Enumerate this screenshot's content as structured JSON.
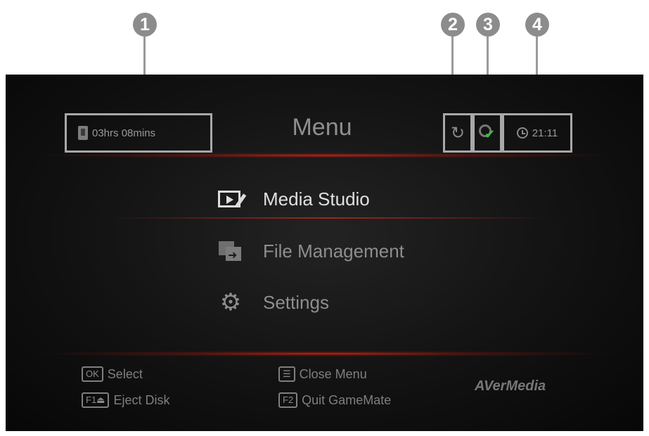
{
  "callouts": [
    "1",
    "2",
    "3",
    "4"
  ],
  "header": {
    "storage_time": "03hrs 08mins",
    "title": "Menu",
    "clock": "21:11"
  },
  "icons": {
    "storage": "usb-drive-icon",
    "sync": "sync-icon",
    "disc_status": "disc-check-icon",
    "clock": "clock-icon",
    "media_studio": "film-edit-icon",
    "file_management": "file-transfer-icon",
    "settings": "gear-icon"
  },
  "menu": {
    "items": [
      {
        "label": "Media Studio",
        "state": "selected"
      },
      {
        "label": "File Management",
        "state": "normal"
      },
      {
        "label": "Settings",
        "state": "normal"
      }
    ]
  },
  "footer": {
    "hints": [
      {
        "key": "OK",
        "label": "Select"
      },
      {
        "key": "F1⏏",
        "label": "Eject Disk"
      },
      {
        "key": "☰",
        "label": "Close Menu"
      },
      {
        "key": "F2",
        "label": "Quit GameMate"
      }
    ],
    "brand": "AVerMedia"
  },
  "colors": {
    "accent_glow": "#d22814",
    "text_active": "#e0e0e0",
    "text_dim": "#8e8e8e",
    "highlight_frame": "#a8a8a8",
    "status_check": "#3fbf3f"
  }
}
